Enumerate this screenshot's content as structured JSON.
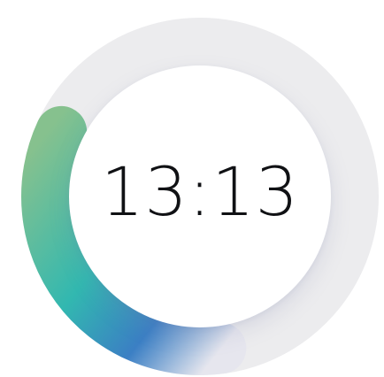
{
  "clock": {
    "time_text": "13:13",
    "progress_fraction": 0.55,
    "colors": {
      "track": "#ececee",
      "progress_start": "#86c18e",
      "progress_mid": "#32b8b0",
      "progress_end": "#3b7fc4",
      "progress_fade": "#e6e6ee",
      "time_text": "#101114"
    }
  }
}
